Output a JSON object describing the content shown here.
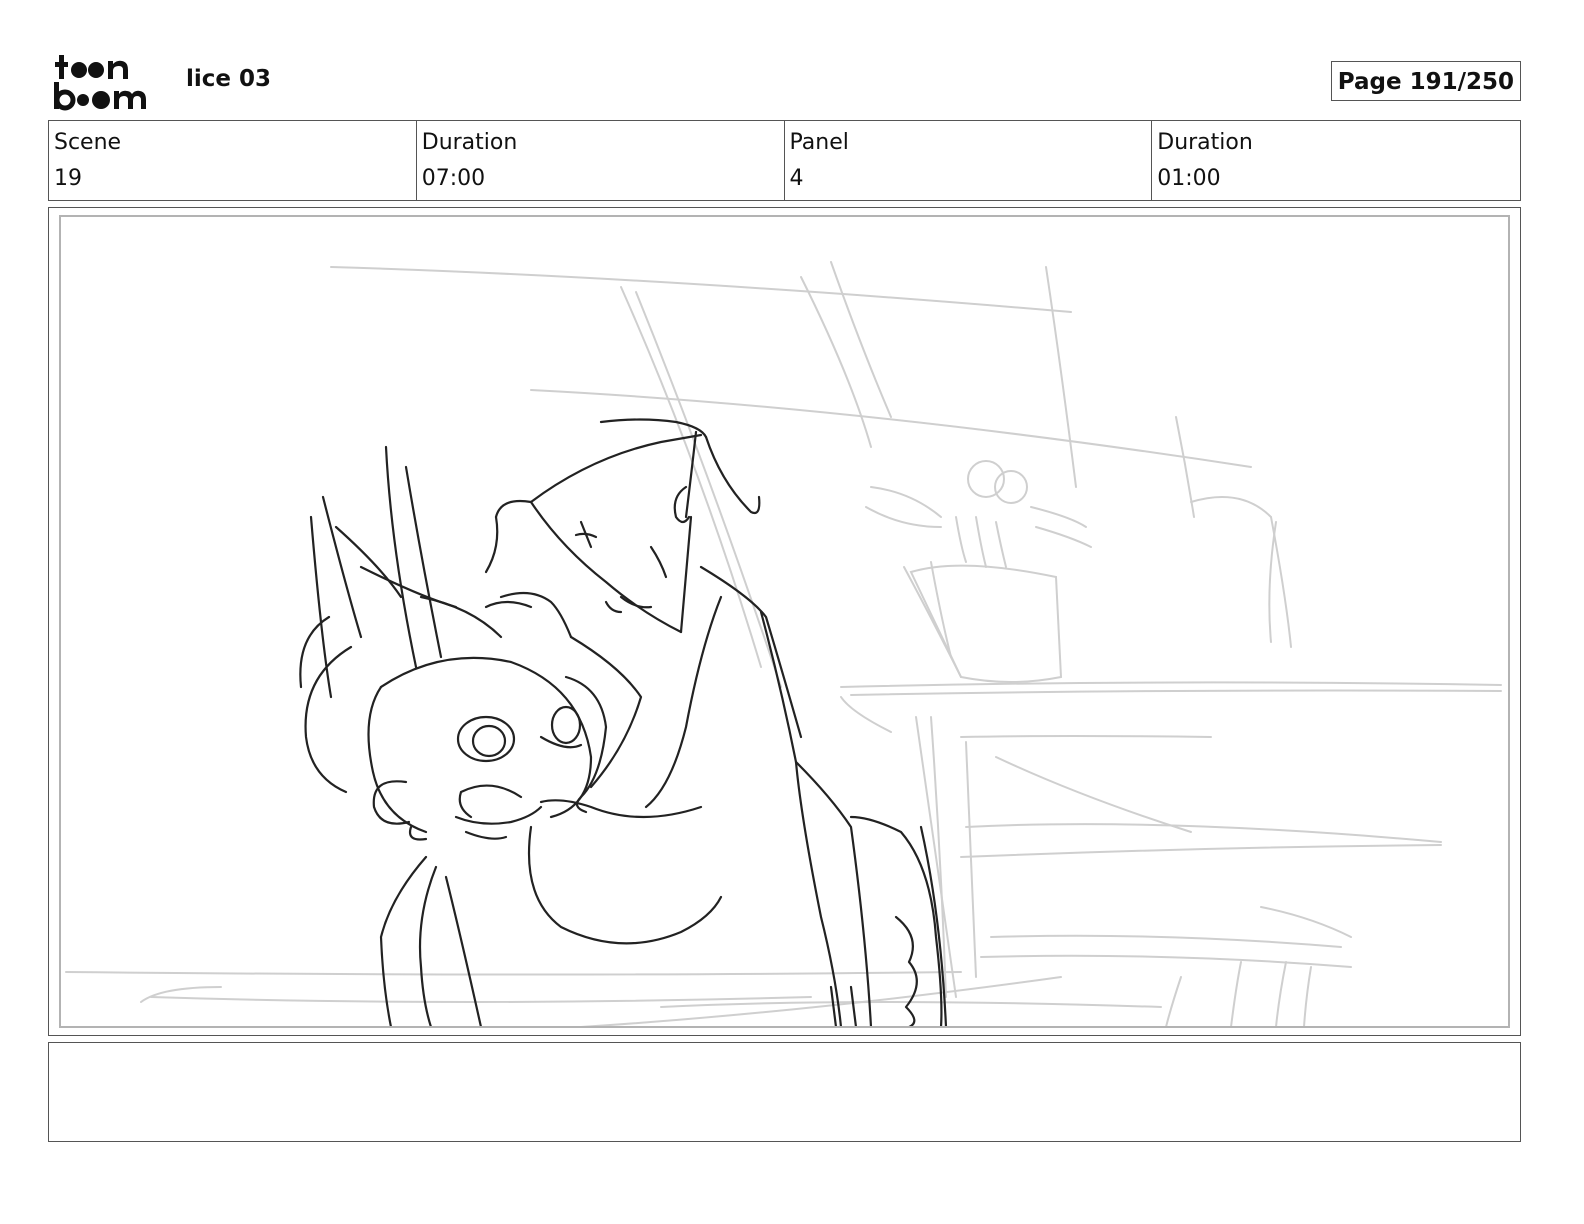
{
  "header": {
    "logo_line1": "toon",
    "logo_line2": "boom",
    "project_title": "lice 03",
    "page_label": "Page 191/250"
  },
  "info": {
    "scene_label": "Scene",
    "scene_value": "19",
    "scene_duration_label": "Duration",
    "scene_duration_value": "07:00",
    "panel_label": "Panel",
    "panel_value": "4",
    "panel_duration_label": "Duration",
    "panel_duration_value": "01:00"
  },
  "notes": {
    "text": ""
  }
}
